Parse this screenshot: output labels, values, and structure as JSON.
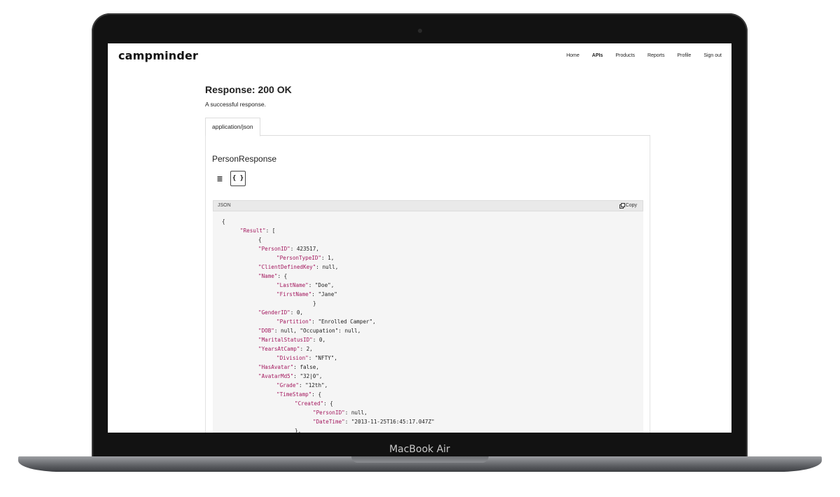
{
  "device": {
    "label": "MacBook Air"
  },
  "app": {
    "logo": "campminder",
    "nav": [
      {
        "label": "Home",
        "active": false
      },
      {
        "label": "APIs",
        "active": true
      },
      {
        "label": "Products",
        "active": false
      },
      {
        "label": "Reports",
        "active": false
      },
      {
        "label": "Profile",
        "active": false
      },
      {
        "label": "Sign out",
        "active": false
      }
    ]
  },
  "response": {
    "title": "Response: 200 OK",
    "description": "A successful response.",
    "tab": "application/json",
    "schema_name": "PersonResponse",
    "view_icons": [
      "list-view-icon",
      "json-view-icon"
    ],
    "code_lang": "JSON",
    "copy_label": "Copy"
  },
  "code_lines": [
    {
      "indent": 0,
      "parts": [
        [
          "p",
          "{"
        ]
      ]
    },
    {
      "indent": 1,
      "parts": [
        [
          "k",
          "\"Result\""
        ],
        [
          "p",
          ": ["
        ]
      ]
    },
    {
      "indent": 2,
      "parts": [
        [
          "p",
          "{"
        ]
      ]
    },
    {
      "indent": 2,
      "parts": [
        [
          "k",
          "\"PersonID\""
        ],
        [
          "p",
          ": 423517,"
        ]
      ]
    },
    {
      "indent": 3,
      "parts": [
        [
          "k",
          "\"PersonTypeID\""
        ],
        [
          "p",
          ": 1,"
        ]
      ]
    },
    {
      "indent": 2,
      "parts": [
        [
          "k",
          "\"ClientDefinedKey\""
        ],
        [
          "p",
          ": null,"
        ]
      ]
    },
    {
      "indent": 2,
      "parts": [
        [
          "k",
          "\"Name\""
        ],
        [
          "p",
          ": {"
        ]
      ]
    },
    {
      "indent": 3,
      "parts": [
        [
          "k",
          "\"LastName\""
        ],
        [
          "p",
          ": \"Doe\","
        ]
      ]
    },
    {
      "indent": 3,
      "parts": [
        [
          "k",
          "\"FirstName\""
        ],
        [
          "p",
          ": \"Jane\""
        ]
      ]
    },
    {
      "indent": 5,
      "parts": [
        [
          "p",
          "}"
        ]
      ]
    },
    {
      "indent": 2,
      "parts": [
        [
          "k",
          "\"GenderID\""
        ],
        [
          "p",
          ": 0,"
        ]
      ]
    },
    {
      "indent": 3,
      "parts": [
        [
          "k",
          "\"Partition\""
        ],
        [
          "p",
          ": \"Enrolled Camper\","
        ]
      ]
    },
    {
      "indent": 2,
      "parts": [
        [
          "k",
          "\"DOB\""
        ],
        [
          "p",
          ": null, \"Occupation\": null,"
        ]
      ]
    },
    {
      "indent": 2,
      "parts": [
        [
          "k",
          "\"MaritalStatusID\""
        ],
        [
          "p",
          ": 0,"
        ]
      ]
    },
    {
      "indent": 2,
      "parts": [
        [
          "k",
          "\"YearsAtCamp\""
        ],
        [
          "p",
          ": 2,"
        ]
      ]
    },
    {
      "indent": 3,
      "parts": [
        [
          "k",
          "\"Division\""
        ],
        [
          "p",
          ": \"NFTY\","
        ]
      ]
    },
    {
      "indent": 2,
      "parts": [
        [
          "k",
          "\"HasAvatar\""
        ],
        [
          "p",
          ": false,"
        ]
      ]
    },
    {
      "indent": 2,
      "parts": [
        [
          "k",
          "\"AvatarMd5\""
        ],
        [
          "p",
          ": \"32|0\","
        ]
      ]
    },
    {
      "indent": 3,
      "parts": [
        [
          "k",
          "\"Grade\""
        ],
        [
          "p",
          ": \"12th\","
        ]
      ]
    },
    {
      "indent": 3,
      "parts": [
        [
          "k",
          "\"TimeStamp\""
        ],
        [
          "p",
          ": {"
        ]
      ]
    },
    {
      "indent": 4,
      "parts": [
        [
          "k",
          "\"Created\""
        ],
        [
          "p",
          ": {"
        ]
      ]
    },
    {
      "indent": 5,
      "parts": [
        [
          "k",
          "\"PersonID\""
        ],
        [
          "p",
          ": null,"
        ]
      ]
    },
    {
      "indent": 5,
      "parts": [
        [
          "k",
          "\"DateTime\""
        ],
        [
          "p",
          ": \"2013-11-25T16:45:17.047Z\""
        ]
      ]
    },
    {
      "indent": 4,
      "parts": [
        [
          "p",
          "},"
        ]
      ]
    }
  ]
}
